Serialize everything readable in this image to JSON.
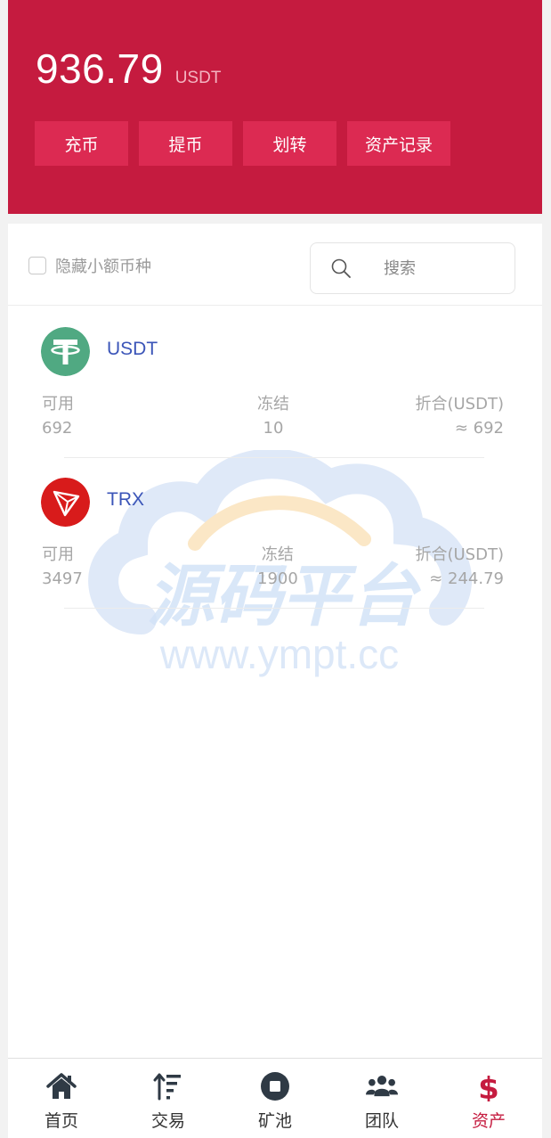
{
  "header": {
    "balance": "936.79",
    "unit": "USDT",
    "actions": [
      {
        "label": "充币"
      },
      {
        "label": "提币"
      },
      {
        "label": "划转"
      },
      {
        "label": "资产记录"
      }
    ],
    "bg_color": "#c51b3f",
    "button_color": "#dc2a52"
  },
  "filter": {
    "hide_small_label": "隐藏小额币种",
    "hide_small_checked": false,
    "search_placeholder": "搜索",
    "search_icon": "search-icon"
  },
  "coins": [
    {
      "name": "USDT",
      "icon": "tether-icon",
      "available_label": "可用",
      "available": "692",
      "frozen_label": "冻结",
      "frozen": "10",
      "value_label": "折合(USDT)",
      "value": "≈ 692"
    },
    {
      "name": "TRX",
      "icon": "tron-icon",
      "available_label": "可用",
      "available": "3497",
      "frozen_label": "冻结",
      "frozen": "1900",
      "value_label": "折合(USDT)",
      "value": "≈ 244.79"
    }
  ],
  "watermark": {
    "title": "源码平台",
    "url": "www.ympt.cc"
  },
  "nav": [
    {
      "label": "首页",
      "icon": "home-icon",
      "active": false
    },
    {
      "label": "交易",
      "icon": "sort-icon",
      "active": false
    },
    {
      "label": "矿池",
      "icon": "stop-circle-icon",
      "active": false
    },
    {
      "label": "团队",
      "icon": "users-icon",
      "active": false
    },
    {
      "label": "资产",
      "icon": "dollar-icon",
      "active": true
    }
  ],
  "active_color": "#c51b3f"
}
